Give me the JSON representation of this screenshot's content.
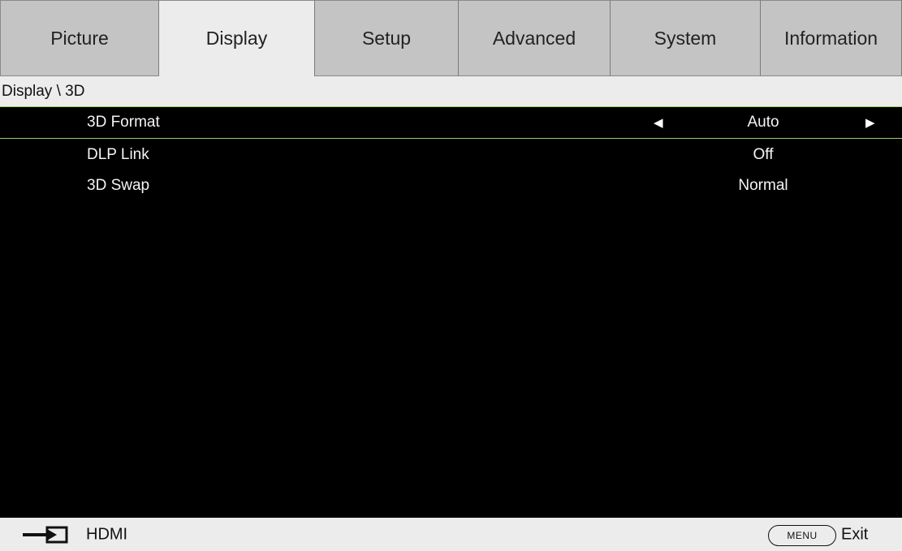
{
  "tabs": [
    {
      "label": "Picture"
    },
    {
      "label": "Display"
    },
    {
      "label": "Setup"
    },
    {
      "label": "Advanced"
    },
    {
      "label": "System"
    },
    {
      "label": "Information"
    }
  ],
  "active_tab": "Display",
  "breadcrumb": "Display \\ 3D",
  "menu": {
    "items": [
      {
        "label": "3D Format",
        "value": "Auto"
      },
      {
        "label": "DLP Link",
        "value": "Off"
      },
      {
        "label": "3D Swap",
        "value": "Normal"
      }
    ]
  },
  "footer": {
    "source_icon": "input-source-icon",
    "source": "HDMI",
    "menu_key": "MENU",
    "exit": "Exit"
  },
  "colors": {
    "tab_bg": "#c4c4c4",
    "tab_active_bg": "#ececec",
    "menu_bg": "#000000",
    "selection_border": "#9bd06a"
  }
}
